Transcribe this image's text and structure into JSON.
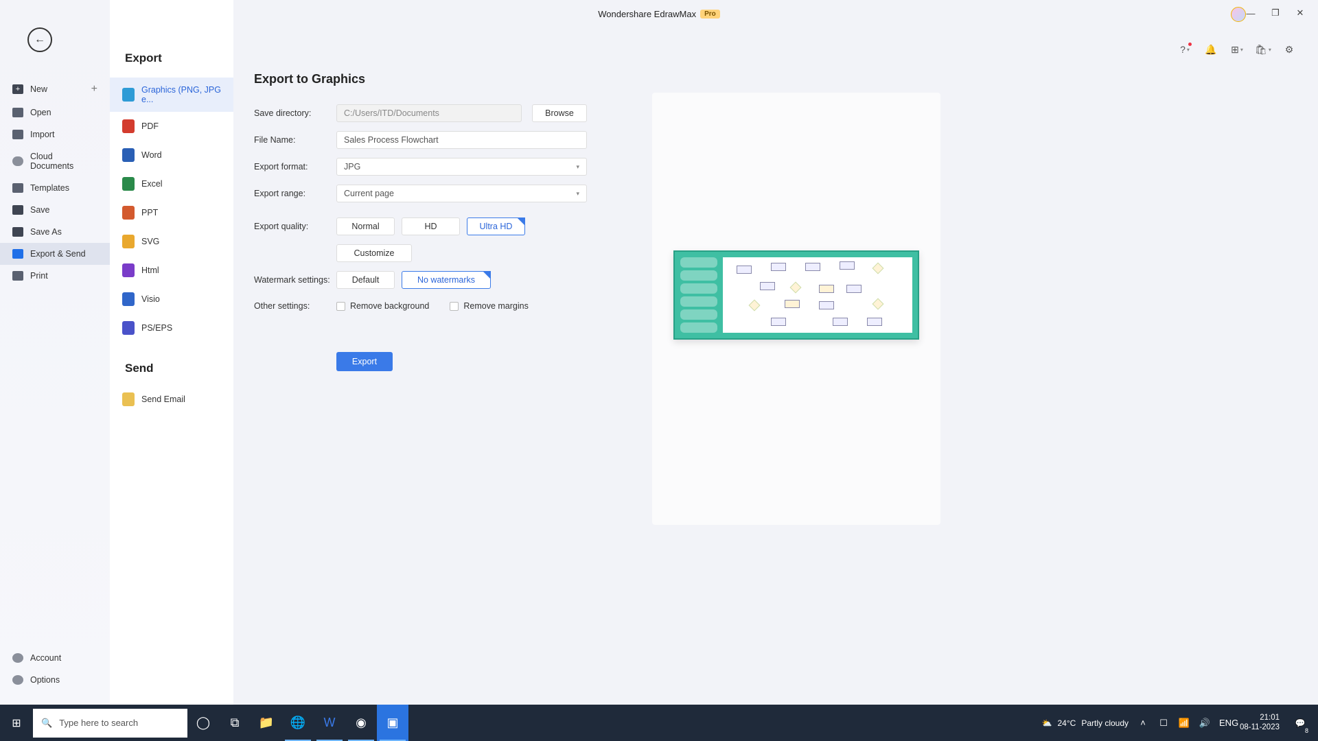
{
  "window": {
    "title": "Wondershare EdrawMax",
    "badge": "Pro"
  },
  "window_controls": {
    "minimize": "—",
    "maximize": "❐",
    "close": "✕"
  },
  "top_icons": {
    "help": "?",
    "bell": "🔔",
    "grid": "⊞",
    "cart": "🛍",
    "gear": "⚙"
  },
  "leftnav": {
    "back": "←",
    "items": [
      {
        "label": "New",
        "icon": "new",
        "plus": true
      },
      {
        "label": "Open",
        "icon": "open"
      },
      {
        "label": "Import",
        "icon": "import"
      },
      {
        "label": "Cloud Documents",
        "icon": "cloud"
      },
      {
        "label": "Templates",
        "icon": "templates"
      },
      {
        "label": "Save",
        "icon": "save"
      },
      {
        "label": "Save As",
        "icon": "saveas"
      },
      {
        "label": "Export & Send",
        "icon": "export",
        "selected": true
      },
      {
        "label": "Print",
        "icon": "print"
      }
    ],
    "bottom": [
      {
        "label": "Account",
        "icon": "account"
      },
      {
        "label": "Options",
        "icon": "options"
      }
    ]
  },
  "formats": {
    "heading_export": "Export",
    "heading_send": "Send",
    "items": [
      {
        "label": "Graphics (PNG, JPG e...",
        "icon": "graphics",
        "selected": true
      },
      {
        "label": "PDF",
        "icon": "pdf"
      },
      {
        "label": "Word",
        "icon": "word"
      },
      {
        "label": "Excel",
        "icon": "excel"
      },
      {
        "label": "PPT",
        "icon": "ppt"
      },
      {
        "label": "SVG",
        "icon": "svg"
      },
      {
        "label": "Html",
        "icon": "html"
      },
      {
        "label": "Visio",
        "icon": "visio"
      },
      {
        "label": "PS/EPS",
        "icon": "ps"
      }
    ],
    "send_items": [
      {
        "label": "Send Email",
        "icon": "email"
      }
    ]
  },
  "form": {
    "heading": "Export to Graphics",
    "save_dir_label": "Save directory:",
    "save_dir_value": "C:/Users/ITD/Documents",
    "browse": "Browse",
    "file_name_label": "File Name:",
    "file_name_value": "Sales Process Flowchart",
    "format_label": "Export format:",
    "format_value": "JPG",
    "range_label": "Export range:",
    "range_value": "Current page",
    "quality_label": "Export quality:",
    "quality_options": [
      "Normal",
      "HD",
      "Ultra HD"
    ],
    "quality_selected": "Ultra HD",
    "customize": "Customize",
    "watermark_label": "Watermark settings:",
    "watermark_options": [
      "Default",
      "No watermarks"
    ],
    "watermark_selected": "No watermarks",
    "other_label": "Other settings:",
    "chk_remove_bg": "Remove background",
    "chk_remove_margins": "Remove margins",
    "export_button": "Export"
  },
  "taskbar": {
    "search_placeholder": "Type here to search",
    "weather_temp": "24°C",
    "weather_text": "Partly cloudy",
    "lang": "ENG",
    "time": "21:01",
    "date": "08-11-2023",
    "notif_count": "8"
  }
}
